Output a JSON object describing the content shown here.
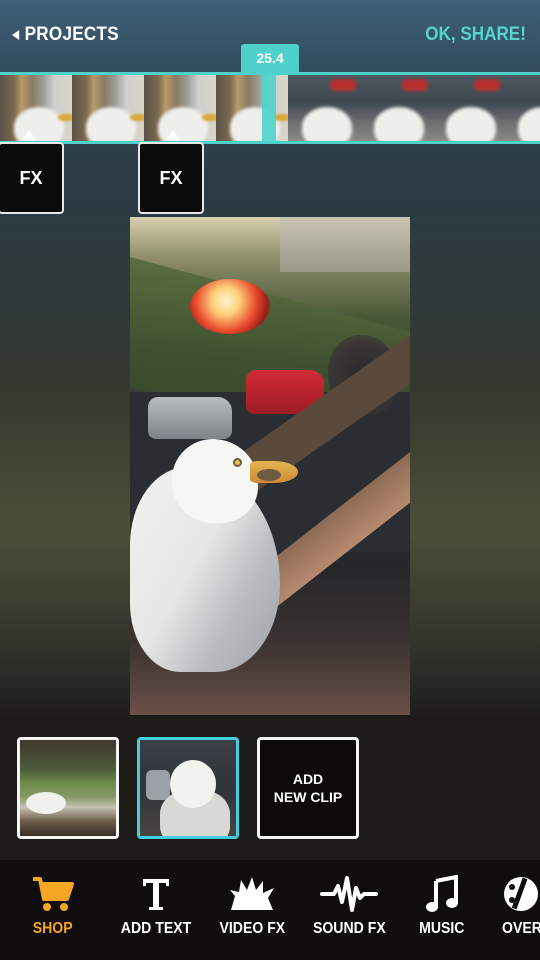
{
  "header": {
    "back_label": "PROJECTS",
    "share_label": "OK, SHARE!"
  },
  "timeline": {
    "playhead_time": "25.4",
    "fx_buttons": [
      "FX",
      "FX"
    ]
  },
  "clips": {
    "add_label_line1": "ADD",
    "add_label_line2": "NEW CLIP",
    "selected_index": 1
  },
  "toolbar": {
    "items": [
      {
        "label": "SHOP",
        "icon": "cart-icon",
        "active": true
      },
      {
        "label": "ADD TEXT",
        "icon": "text-icon",
        "active": false
      },
      {
        "label": "VIDEO FX",
        "icon": "explosion-icon",
        "active": false
      },
      {
        "label": "SOUND FX",
        "icon": "waveform-icon",
        "active": false
      },
      {
        "label": "MUSIC",
        "icon": "music-note-icon",
        "active": false
      },
      {
        "label": "OVERL",
        "icon": "film-reel-icon",
        "active": false
      }
    ]
  },
  "colors": {
    "accent": "#4fd1cb",
    "active_tool": "#f5a623",
    "selected_clip": "#42d0e0"
  }
}
